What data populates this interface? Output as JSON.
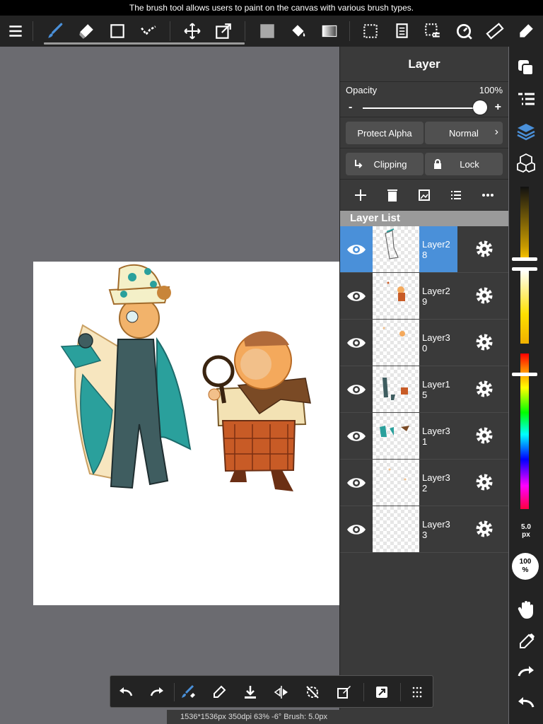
{
  "tooltip": "The brush tool allows users to paint on the canvas with various brush types.",
  "toolbar": {
    "tools": [
      "menu-icon",
      "brush-icon",
      "eraser-icon",
      "rect-select-icon",
      "lasso-icon",
      "move-icon",
      "transform-icon",
      "color-fill-icon",
      "bucket-icon",
      "gradient-icon",
      "select-none-icon",
      "copy-icon",
      "select-all-icon",
      "rotate-icon",
      "ruler-icon",
      "pen-icon"
    ],
    "accent": "#4a90d9"
  },
  "layer_panel": {
    "title": "Layer",
    "opacity_label": "Opacity",
    "opacity_value": "100%",
    "opacity_fraction": 1.0,
    "slider_minus": "-",
    "slider_plus": "+",
    "protect_alpha": "Protect Alpha",
    "blend_mode": "Normal",
    "clipping": "Clipping",
    "lock": "Lock",
    "list_header": "Layer List",
    "layers": [
      {
        "name": "Layer28",
        "selected": true
      },
      {
        "name": "Layer29",
        "selected": false
      },
      {
        "name": "Layer30",
        "selected": false
      },
      {
        "name": "Layer15",
        "selected": false
      },
      {
        "name": "Layer31",
        "selected": false
      },
      {
        "name": "Layer32",
        "selected": false
      },
      {
        "name": "Layer33",
        "selected": false
      }
    ]
  },
  "right_bar": {
    "brush_size": "5.0",
    "brush_size_unit": "px",
    "brush_opacity": "100",
    "brush_opacity_unit": "%"
  },
  "status": "1536*1536px 350dpi 63% -6° Brush: 5.0px"
}
